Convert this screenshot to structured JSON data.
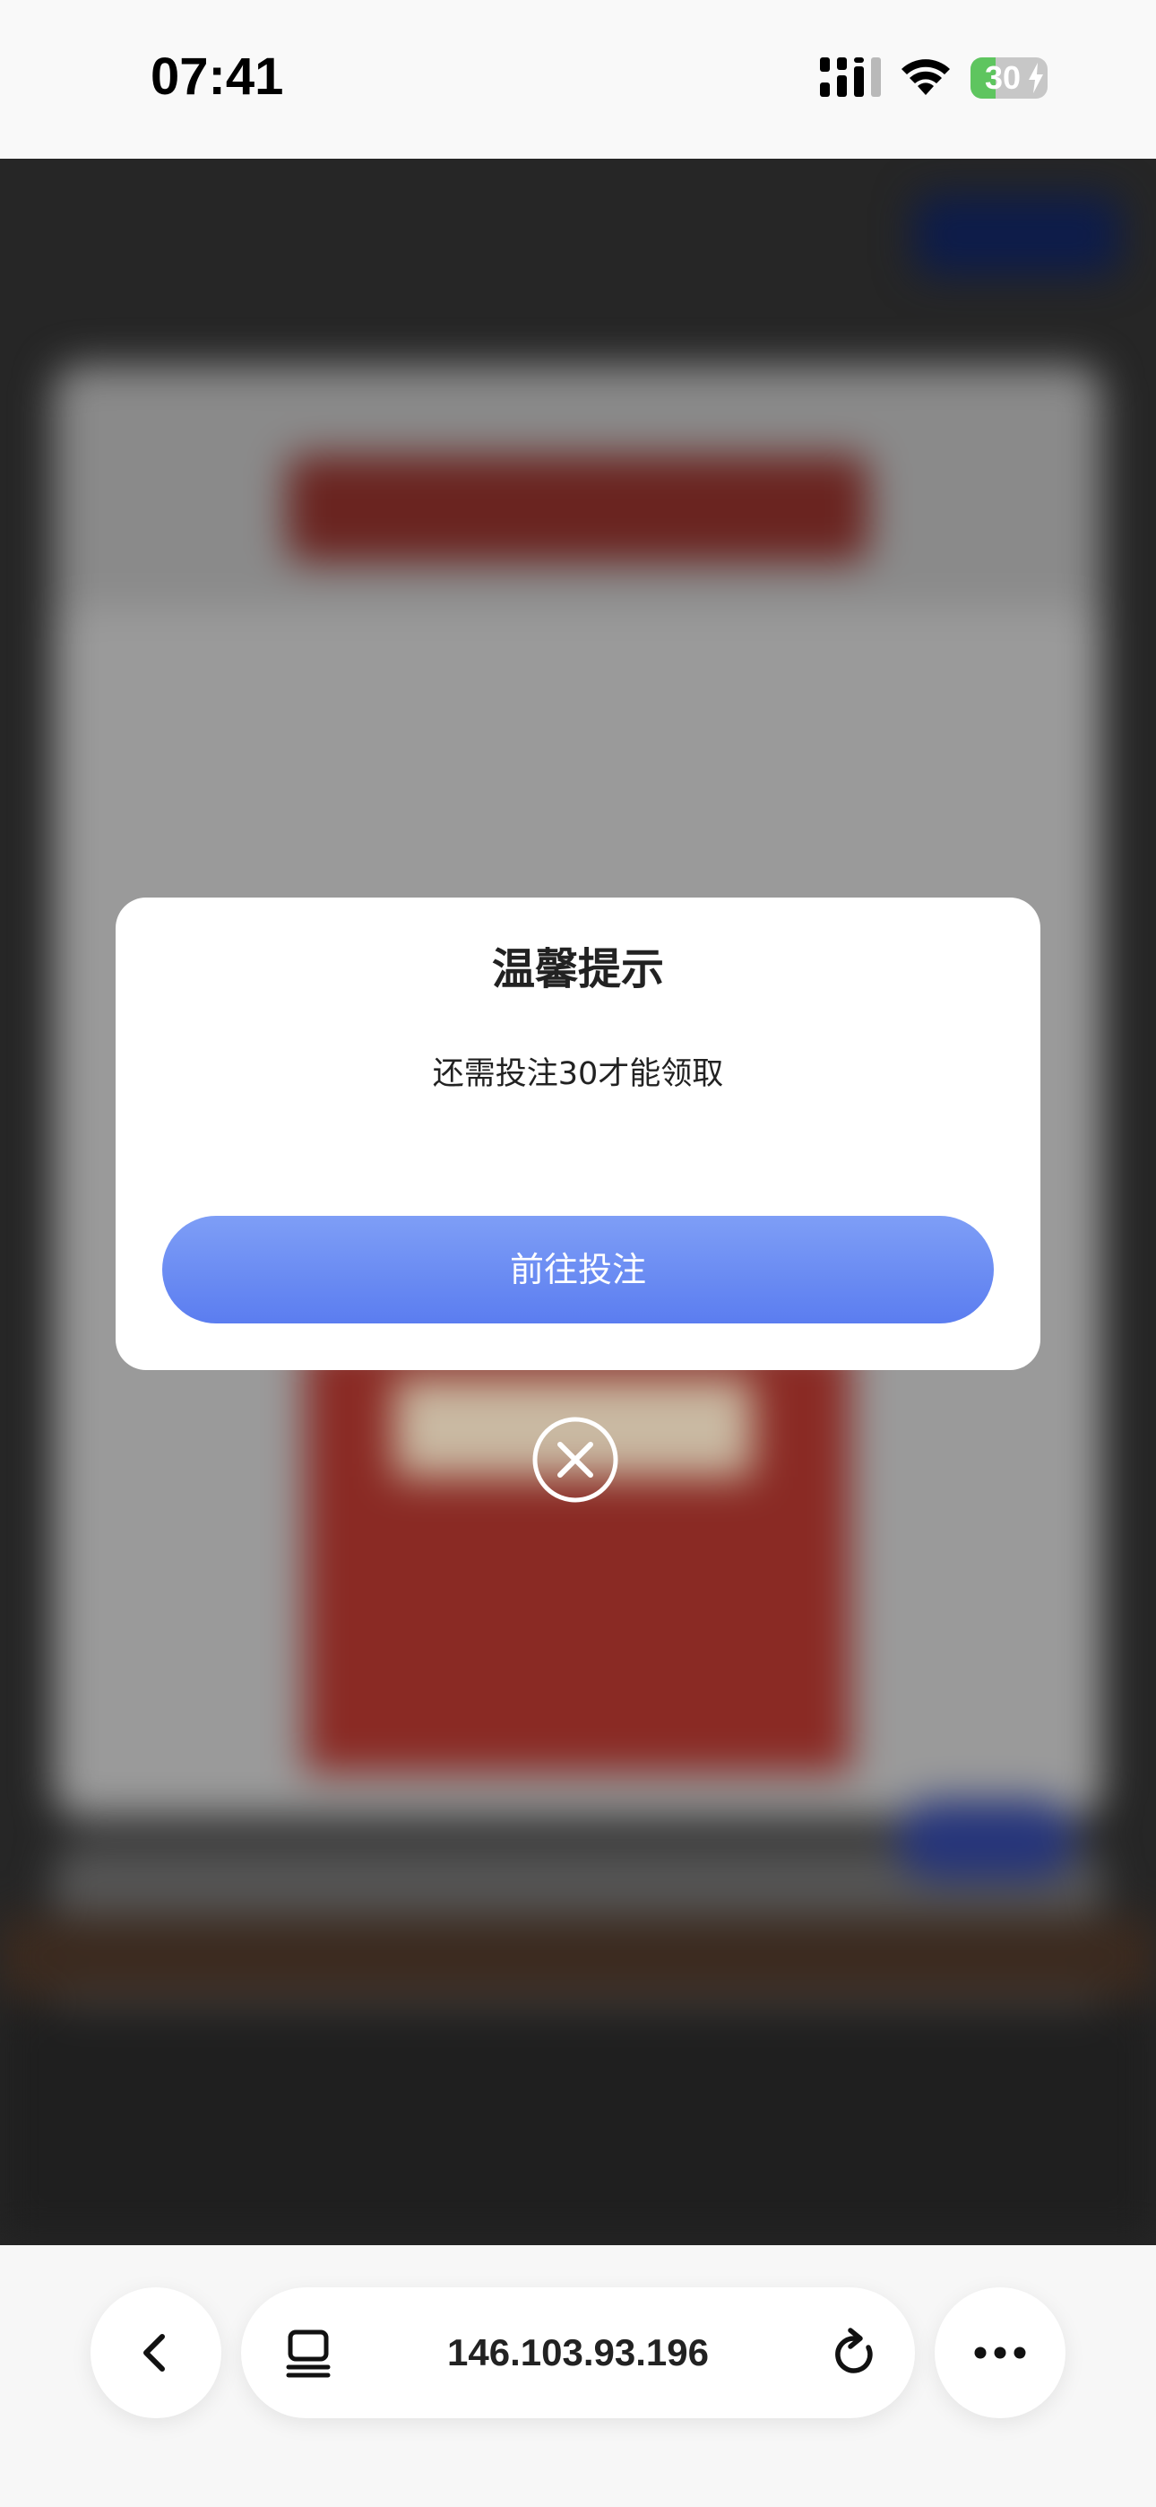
{
  "status_bar": {
    "time": "07:41",
    "battery_level": "30",
    "icons": [
      "signal-icon",
      "wifi-icon",
      "battery-icon",
      "charging-bolt-icon"
    ]
  },
  "dialog": {
    "title": "温馨提示",
    "message": "还需投注30才能领取",
    "confirm_label": "前往投注",
    "close_icon": "close-circle-icon",
    "accent_color": "#6a8cf3"
  },
  "browser": {
    "url": "146.103.93.196",
    "icons": [
      "back-chevron-icon",
      "tabs-icon",
      "reload-icon",
      "more-dots-icon"
    ]
  }
}
